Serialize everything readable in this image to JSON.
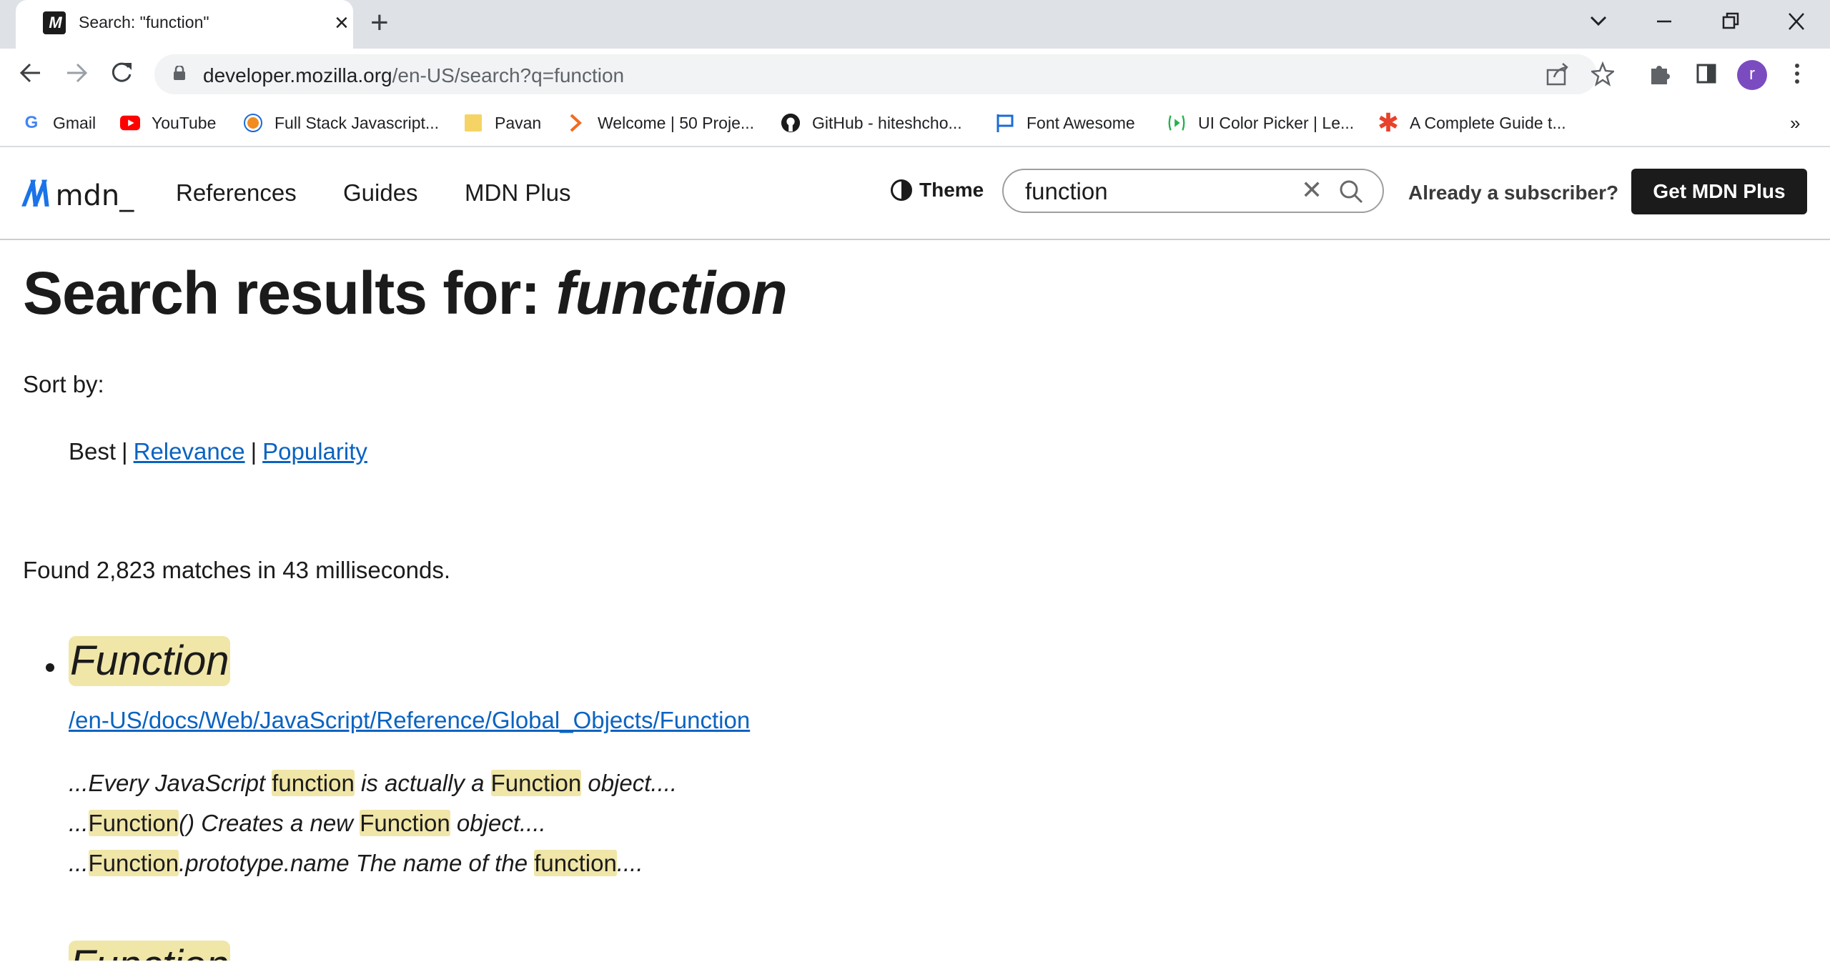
{
  "browser": {
    "tab_title": "Search: \"function\"",
    "url_host": "developer.mozilla.org",
    "url_path": "/en-US/search?q=function",
    "profile_initial": "r",
    "bookmarks": [
      {
        "label": "Gmail",
        "icon": "gmail-icon",
        "color": "#4285f4"
      },
      {
        "label": "YouTube",
        "icon": "youtube-icon",
        "color": "#ff0000"
      },
      {
        "label": "Full Stack Javascript...",
        "icon": "fullstack-icon",
        "color": "#f28b20"
      },
      {
        "label": "Pavan",
        "icon": "folder-icon",
        "color": "#f6d365"
      },
      {
        "label": "Welcome | 50 Proje...",
        "icon": "chevron-brand-icon",
        "color": "#f26b21"
      },
      {
        "label": "GitHub - hiteshcho...",
        "icon": "github-icon",
        "color": "#1b1b1b"
      },
      {
        "label": "Font Awesome",
        "icon": "flag-icon",
        "color": "#1c6bd6"
      },
      {
        "label": "UI Color Picker | Le...",
        "icon": "color-picker-icon",
        "color": "#22b24c"
      },
      {
        "label": "A Complete Guide t...",
        "icon": "asterisk-icon",
        "color": "#e8412c"
      }
    ],
    "more_bookmarks": "»"
  },
  "header": {
    "logo_text": "mdn_",
    "nav": [
      "References",
      "Guides",
      "MDN Plus"
    ],
    "theme_label": "Theme",
    "search_value": "function",
    "subscriber_text": "Already a subscriber?",
    "cta_label": "Get MDN Plus"
  },
  "main": {
    "heading_prefix": "Search results for: ",
    "heading_query": "function",
    "sort_label": "Sort by:",
    "sort_current": "Best",
    "sort_links": [
      "Relevance",
      "Popularity"
    ],
    "found_text": "Found 2,823 matches in 43 milliseconds.",
    "results": [
      {
        "title": "Function",
        "url": "/en-US/docs/Web/JavaScript/Reference/Global_Objects/Function",
        "snippets": [
          [
            {
              "t": "...Every JavaScript ",
              "h": false
            },
            {
              "t": "function",
              "h": true
            },
            {
              "t": " is actually a ",
              "h": false
            },
            {
              "t": "Function",
              "h": true
            },
            {
              "t": " object....",
              "h": false
            }
          ],
          [
            {
              "t": "...",
              "h": false
            },
            {
              "t": "Function",
              "h": true
            },
            {
              "t": "() Creates a new ",
              "h": false
            },
            {
              "t": "Function",
              "h": true
            },
            {
              "t": " object....",
              "h": false
            }
          ],
          [
            {
              "t": "...",
              "h": false
            },
            {
              "t": "Function",
              "h": true
            },
            {
              "t": ".prototype.name The name of the ",
              "h": false
            },
            {
              "t": "function",
              "h": true
            },
            {
              "t": "....",
              "h": false
            }
          ]
        ]
      },
      {
        "title": "Function",
        "url": "",
        "snippets": []
      }
    ]
  }
}
